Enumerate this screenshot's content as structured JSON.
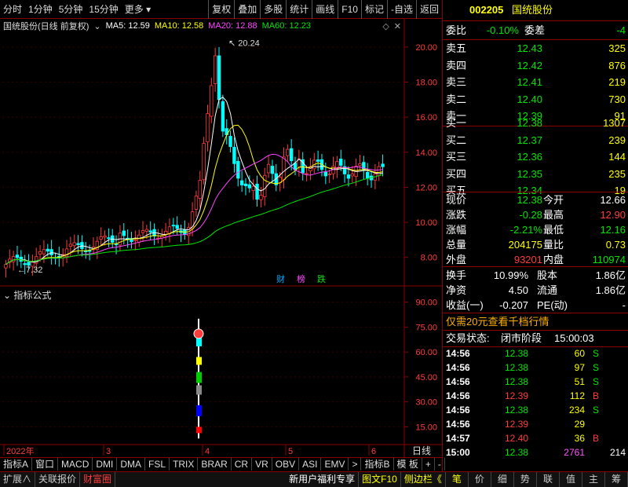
{
  "toolbar": {
    "left": [
      "分时",
      "1分钟",
      "5分钟",
      "15分钟",
      "更多"
    ],
    "right": [
      "复权",
      "叠加",
      "多股",
      "统计",
      "画线",
      "F10",
      "标记",
      "-自选",
      "返回"
    ]
  },
  "main_header": {
    "title": "国统股份(日线 前复权)",
    "ma5": "MA5: 12.59",
    "ma10": "MA10: 12.58",
    "ma20": "MA20: 12.88",
    "ma60": "MA60: 12.23"
  },
  "chart_data": {
    "type": "candlestick",
    "y_ticks": [
      "20.00",
      "18.00",
      "16.00",
      "14.00",
      "12.00",
      "10.00",
      "8.00"
    ],
    "ylim": [
      7.0,
      20.8
    ],
    "high_label": "20.24",
    "low_label": "7.32",
    "x_labels": [
      "2022年",
      "3",
      "4",
      "5",
      "6"
    ],
    "markers": [
      "财",
      "榜",
      "跌"
    ],
    "indicator_ticks": [
      "90.00",
      "75.00",
      "60.00",
      "45.00",
      "30.00",
      "15.00"
    ],
    "period_label": "日线"
  },
  "indicator_header": "指标公式",
  "stock": {
    "code": "002205",
    "name": "国统股份"
  },
  "quote": {
    "weibi_label": "委比",
    "weibi": "-0.10%",
    "weicha_label": "委差",
    "weicha": "-4",
    "asks": [
      {
        "label": "卖五",
        "price": "12.43",
        "vol": "325"
      },
      {
        "label": "卖四",
        "price": "12.42",
        "vol": "876"
      },
      {
        "label": "卖三",
        "price": "12.41",
        "vol": "219"
      },
      {
        "label": "卖二",
        "price": "12.40",
        "vol": "730"
      },
      {
        "label": "卖一",
        "price": "12.39",
        "vol": "91"
      }
    ],
    "bids": [
      {
        "label": "买一",
        "price": "12.38",
        "vol": "1307"
      },
      {
        "label": "买二",
        "price": "12.37",
        "vol": "239"
      },
      {
        "label": "买三",
        "price": "12.36",
        "vol": "144"
      },
      {
        "label": "买四",
        "price": "12.35",
        "vol": "235"
      },
      {
        "label": "买五",
        "price": "12.34",
        "vol": "19"
      }
    ],
    "stats": [
      {
        "l1": "现价",
        "v1": "12.38",
        "l2": "今开",
        "v2": "12.66",
        "c1": "green",
        "c2": "white"
      },
      {
        "l1": "涨跌",
        "v1": "-0.28",
        "l2": "最高",
        "v2": "12.90",
        "c1": "green",
        "c2": "red"
      },
      {
        "l1": "涨幅",
        "v1": "-2.21%",
        "l2": "最低",
        "v2": "12.16",
        "c1": "green",
        "c2": "green"
      },
      {
        "l1": "总量",
        "v1": "204175",
        "l2": "量比",
        "v2": "0.73",
        "c1": "yellow",
        "c2": "yellow"
      },
      {
        "l1": "外盘",
        "v1": "93201",
        "l2": "内盘",
        "v2": "110974",
        "c1": "red",
        "c2": "green"
      }
    ],
    "fin": [
      {
        "l1": "换手",
        "v1": "10.99%",
        "l2": "股本",
        "v2": "1.86亿"
      },
      {
        "l1": "净资",
        "v1": "4.50",
        "l2": "流通",
        "v2": "1.86亿"
      },
      {
        "l1": "收益(一)",
        "v1": "-0.207",
        "l2": "PE(动)",
        "v2": "-"
      }
    ],
    "promo": "仅需20元查看千档行情",
    "status_label": "交易状态:",
    "status_value": "闭市阶段",
    "status_time": "15:00:03",
    "ticks": [
      {
        "t": "14:56",
        "p": "12.38",
        "v": "60",
        "s": "S"
      },
      {
        "t": "14:56",
        "p": "12.38",
        "v": "97",
        "s": "S"
      },
      {
        "t": "14:56",
        "p": "12.38",
        "v": "51",
        "s": "S"
      },
      {
        "t": "14:56",
        "p": "12.39",
        "v": "112",
        "s": "B"
      },
      {
        "t": "14:56",
        "p": "12.38",
        "v": "234",
        "s": "S"
      },
      {
        "t": "14:56",
        "p": "12.39",
        "v": "29",
        "s": ""
      },
      {
        "t": "14:57",
        "p": "12.40",
        "v": "36",
        "s": "B"
      },
      {
        "t": "15:00",
        "p": "12.38",
        "v": "2761",
        "s": "214"
      }
    ]
  },
  "tabs": [
    "指标A",
    "窗口",
    "MACD",
    "DMI",
    "DMA",
    "FSL",
    "TRIX",
    "BRAR",
    "CR",
    "VR",
    "OBV",
    "ASI",
    "EMV",
    ">",
    "指标B",
    "模 板",
    "+",
    "-"
  ],
  "bottom_left": [
    "扩展∧",
    "关联报价",
    "财富圈"
  ],
  "bottom_mid": [
    "新用户福利专享",
    "图文F10",
    "侧边栏《"
  ],
  "bottom_right": [
    "笔",
    "价",
    "细",
    "势",
    "联",
    "值",
    "主",
    "筹"
  ]
}
